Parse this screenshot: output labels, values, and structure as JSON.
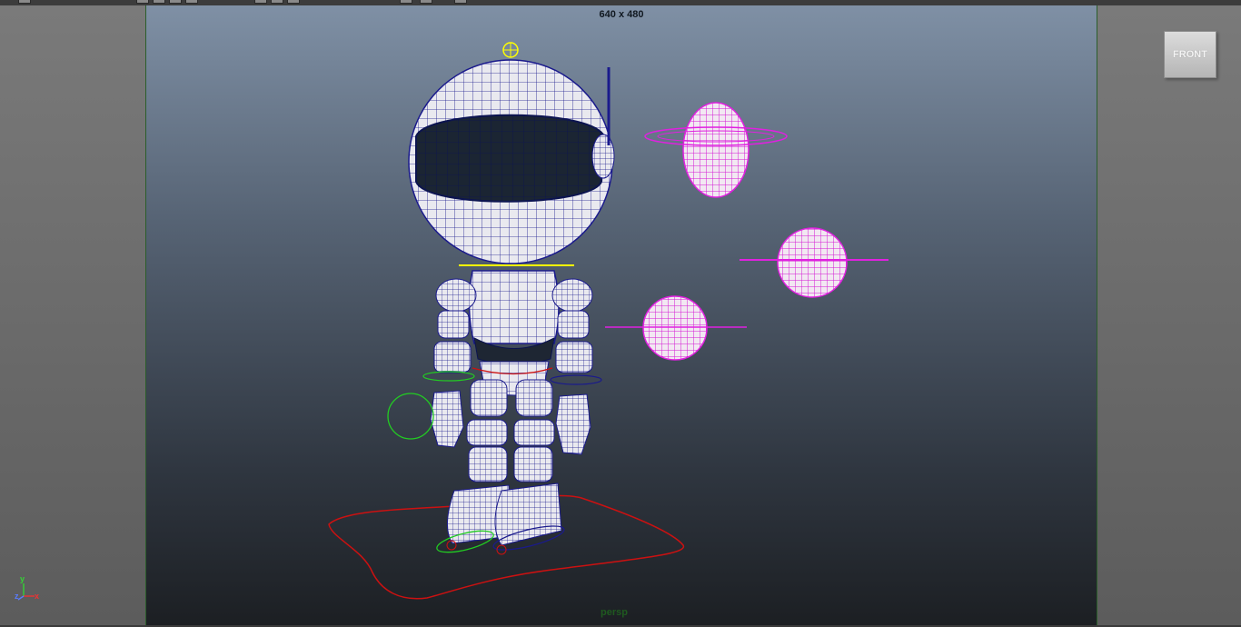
{
  "viewport": {
    "resolution_gate_label": "640 x 480",
    "camera_label": "persp"
  },
  "viewcube": {
    "face_label": "FRONT"
  },
  "axis_gizmo": {
    "y": "y",
    "x": "x",
    "z": "z"
  },
  "colors": {
    "wireframe": "#1a1a8c",
    "controls": "#e020e0",
    "selection": "#ffff00",
    "ground_curve": "#cc1111",
    "control_green": "#22cc22"
  },
  "scene_objects": [
    "astronaut-robot-mesh",
    "planet-1",
    "planet-2",
    "planet-3",
    "ground-control-curve"
  ]
}
